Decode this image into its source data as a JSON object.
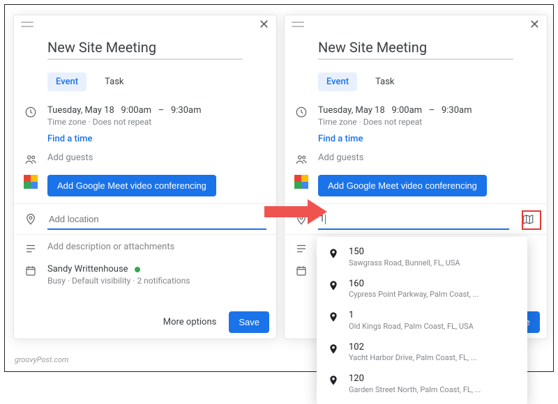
{
  "title": "New Site Meeting",
  "tabs": {
    "event": "Event",
    "task": "Task"
  },
  "datetime": {
    "date": "Tuesday, May 18",
    "start": "9:00am",
    "dash": "–",
    "end": "9:30am",
    "sub": "Time zone · Does not repeat",
    "find": "Find a time"
  },
  "guests": {
    "placeholder": "Add guests"
  },
  "meet": {
    "button": "Add Google Meet video conferencing"
  },
  "location": {
    "placeholder": "Add location",
    "typed": "1"
  },
  "description": {
    "placeholder": "Add description or attachments"
  },
  "calendar": {
    "owner": "Sandy Writtenhouse",
    "detail": "Busy · Default visibility · 2 notifications"
  },
  "footer": {
    "more": "More options",
    "save": "Save"
  },
  "credit": "groovyPost.com",
  "suggestions": [
    {
      "title": "150",
      "sub": "Sawgrass Road, Bunnell, FL, USA"
    },
    {
      "title": "160",
      "sub": "Cypress Point Parkway, Palm Coast, ..."
    },
    {
      "title": "1",
      "sub": "Old Kings Road, Palm Coast, FL, USA"
    },
    {
      "title": "102",
      "sub": "Yacht Harbor Drive, Palm Coast, FL, ..."
    },
    {
      "title": "120",
      "sub": "Garden Street North, Palm Coast, FL, ..."
    }
  ]
}
